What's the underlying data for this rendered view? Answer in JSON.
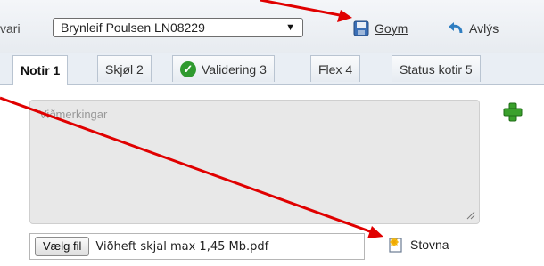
{
  "toolbar": {
    "responsible_label": "vari",
    "responsible_value": "Brynleif Poulsen LN08229",
    "save_label": "Goym",
    "cancel_label": "Avlýs"
  },
  "tabs": [
    {
      "label": "Notir 1",
      "active": true
    },
    {
      "label": "Skjøl 2",
      "active": false
    },
    {
      "label": "Validering 3",
      "active": false
    },
    {
      "label": "Flex 4",
      "active": false
    },
    {
      "label": "Status kotir 5",
      "active": false
    }
  ],
  "notes": {
    "placeholder": "Viðmerkingar"
  },
  "file": {
    "choose_label": "Vælg fil",
    "file_name": "Viðheft skjal max 1,45 Mb.pdf",
    "create_label": "Stovna"
  },
  "colors": {
    "annotation_arrow": "#e00000",
    "check_green": "#2f9a2f",
    "add_green": "#3aa02c"
  },
  "icons": {
    "save": "floppy-disk-icon",
    "cancel": "undo-arrow-icon",
    "validation": "checkmark-circle-icon",
    "add": "green-plus-icon",
    "create": "new-document-icon"
  }
}
